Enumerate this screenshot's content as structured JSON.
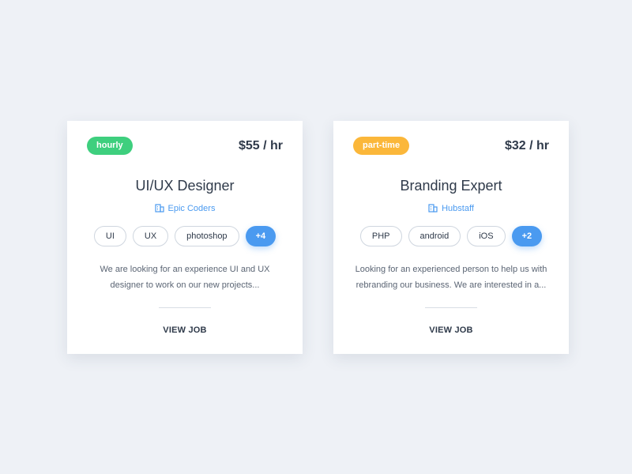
{
  "colors": {
    "background": "#eef1f6",
    "accent": "#4a9af0",
    "hourly_badge": "#3ecf7e",
    "parttime_badge": "#fbb73a"
  },
  "jobs": [
    {
      "type": "hourly",
      "type_color": "#3ecf7e",
      "rate": "$55 / hr",
      "title": "UI/UX Designer",
      "company": "Epic Coders",
      "company_icon": "building-icon",
      "tags": [
        "UI",
        "UX",
        "photoshop"
      ],
      "more_tags": "+4",
      "description": "We are looking for an experience UI and UX designer to work on our new projects...",
      "action": "VIEW JOB"
    },
    {
      "type": "part-time",
      "type_color": "#fbb73a",
      "rate": "$32 / hr",
      "title": "Branding Expert",
      "company": "Hubstaff",
      "company_icon": "building-icon",
      "tags": [
        "PHP",
        "android",
        "iOS"
      ],
      "more_tags": "+2",
      "description": "Looking for an experienced person to help us with rebranding our business. We are interested in a...",
      "action": "VIEW JOB"
    }
  ]
}
